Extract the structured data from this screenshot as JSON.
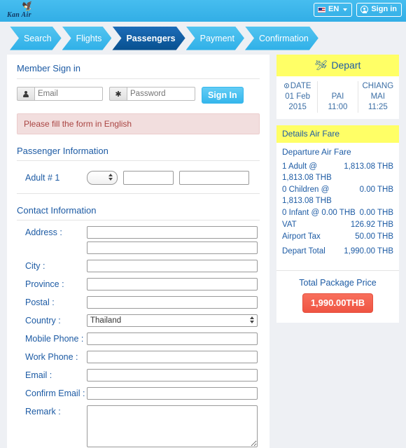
{
  "header": {
    "logo_bird_icon": "bird-icon",
    "logo_text": "Kan Air",
    "language": {
      "label": "EN",
      "flag_icon": "us-flag-icon",
      "caret_icon": "chevron-down-icon"
    },
    "signin": {
      "label": "Sign in",
      "icon": "person-icon"
    }
  },
  "steps": [
    {
      "label": "Search",
      "active": false
    },
    {
      "label": "Flights",
      "active": false
    },
    {
      "label": "Passengers",
      "active": true
    },
    {
      "label": "Payment",
      "active": false
    },
    {
      "label": "Confirmation",
      "active": false
    }
  ],
  "member_signin": {
    "title": "Member Sign in",
    "email_placeholder": "Email",
    "email_value": "",
    "email_icon": "person-icon",
    "password_placeholder": "Password",
    "password_value": "",
    "password_icon": "asterisk-icon",
    "button_label": "Sign In"
  },
  "alert": {
    "message": "Please fill the form in English"
  },
  "passenger_information": {
    "title": "Passenger Information",
    "row_label": "Adult # 1",
    "title_select_value": "",
    "firstname_value": "",
    "lastname_value": ""
  },
  "contact_information": {
    "title": "Contact Information",
    "fields": [
      {
        "label": "Address :",
        "type": "text",
        "value": ""
      },
      {
        "label": "",
        "type": "text",
        "value": ""
      },
      {
        "label": "City :",
        "type": "text",
        "value": ""
      },
      {
        "label": "Province :",
        "type": "text",
        "value": ""
      },
      {
        "label": "Postal :",
        "type": "text",
        "value": ""
      },
      {
        "label": "Country :",
        "type": "select",
        "value": "Thailand"
      },
      {
        "label": "Mobile Phone :",
        "type": "text",
        "value": ""
      },
      {
        "label": "Work Phone :",
        "type": "text",
        "value": ""
      },
      {
        "label": "Email :",
        "type": "text",
        "value": ""
      },
      {
        "label": "Confirm Email :",
        "type": "text",
        "value": ""
      },
      {
        "label": "Remark :",
        "type": "textarea",
        "value": ""
      }
    ]
  },
  "depart": {
    "title": "Depart",
    "plane_icon": "plane-takeoff-icon",
    "date_head": "DATE",
    "date_line1": "01 Feb",
    "date_line2": "2015",
    "origin_code": "PAI",
    "origin_time": "11:00",
    "destination_line1": "CHIANG",
    "destination_line2": "MAI",
    "destination_time": "11:25",
    "clock_icon": "clock-icon"
  },
  "fare": {
    "head": "Details Air Fare",
    "subhead": "Departure Air Fare",
    "lines": [
      {
        "desc": "1 Adult @ 1,813.08 THB",
        "amount": "1,813.08",
        "currency": "THB"
      },
      {
        "desc": "0 Children @ 1,813.08 THB",
        "amount": "0.00",
        "currency": "THB"
      },
      {
        "desc": "0 Infant @ 0.00 THB",
        "amount": "0.00",
        "currency": "THB"
      },
      {
        "desc": "VAT",
        "amount": "126.92",
        "currency": "THB"
      },
      {
        "desc": "Airport Tax",
        "amount": "50.00",
        "currency": "THB"
      }
    ],
    "total_label": "Depart Total",
    "total_amount": "1,990.00",
    "total_currency": "THB"
  },
  "total_package": {
    "label": "Total Package Price",
    "price": "1,990.00THB",
    "color": "#f4614f"
  }
}
